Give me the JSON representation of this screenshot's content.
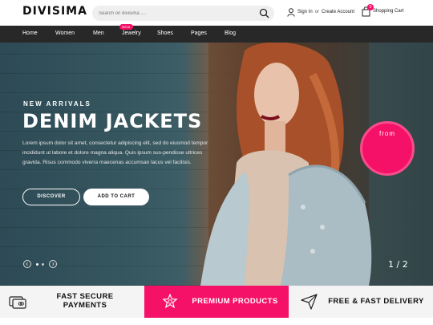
{
  "header": {
    "logo": "DIVISIMA",
    "search_placeholder": "Search on divisima ....",
    "sign_in": "Sign In",
    "or": "or",
    "create_account": "Create Account",
    "cart_label": "Shopping Cart",
    "cart_count": "0"
  },
  "nav": {
    "items": [
      "Home",
      "Women",
      "Men",
      "Jewelry",
      "Shoes",
      "Pages",
      "Blog"
    ],
    "new_badge": "NEW"
  },
  "hero": {
    "subtitle": "NEW ARRIVALS",
    "title": "DENIM JACKETS",
    "text": "Lorem ipsum dolor sit amet, consectetur adipiscing elit, sed do eiusmod tempor incididunt ut labore et dolore magna aliqua. Quis ipsum sus-pendisse ultrices gravida. Risus commodo viverra maecenas accumsan lacus vel facilisis.",
    "discover_button": "DISCOVER",
    "add_to_cart_button": "ADD TO CART",
    "price_from": "from",
    "slide_counter": "1 / 2"
  },
  "features": [
    {
      "label": "FAST SECURE PAYMENTS",
      "icon": "card-icon"
    },
    {
      "label": "PREMIUM PRODUCTS",
      "icon": "star-badge-icon"
    },
    {
      "label": "FREE & FAST DELIVERY",
      "icon": "paper-plane-icon"
    }
  ],
  "colors": {
    "accent": "#f51167",
    "nav_bg": "#282828",
    "feature_bg": "#f4f4f4"
  }
}
